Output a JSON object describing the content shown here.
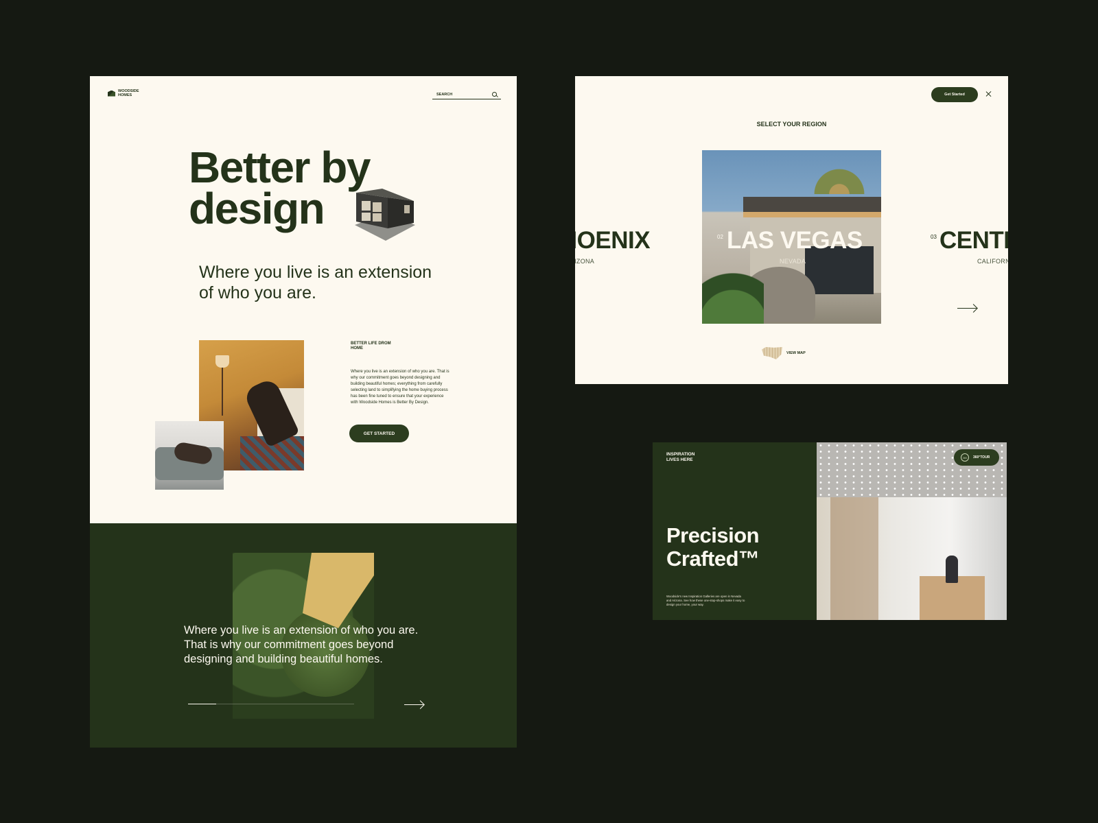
{
  "home": {
    "logo_text": "WOODSIDE HOMES",
    "search_label": "SEARCH",
    "hero_line1": "Better by",
    "hero_line2": "design",
    "subtitle": "Where you live is an extension of who you are.",
    "kicker": "BETTER LIFE DROM HOME",
    "body": "Where you live is an extension of who you are. That is why our commitment goes beyond designing and building beautiful homes; everything from carefully selecting land to simplifying the home buying process has been fine tuned to ensure that your experience with Woodside Homes is Better By Design.",
    "cta": "GET STARTED"
  },
  "quote": {
    "text": "Where you live is an extension of who you are. That is why our commitment goes beyond designing and building beautiful homes.",
    "progress": 0.17
  },
  "region": {
    "cta": "Get Started",
    "title": "SELECT YOUR REGION",
    "regions": [
      {
        "num": "",
        "city": "PHOENIX",
        "state": "ARIZONA"
      },
      {
        "num": "02",
        "city": "LAS VEGAS",
        "state": "NEVADA"
      },
      {
        "num": "03",
        "city": "CENTRAL",
        "state": "CALIFORNIA"
      }
    ],
    "view_map": "VIEW MAP"
  },
  "precision": {
    "kicker": "INSPIRATION LIVES HERE",
    "title_line1": "Precision",
    "title_line2": "Crafted™",
    "body": "Woodside's new Inspiration Galleries are open in Nevada and Arizona. See how these one-stop-shops make it easy to design your home, your way.",
    "tour_label": "360°TOUR",
    "tour_icon_text": "360"
  },
  "colors": {
    "brand_green": "#24331a",
    "cream": "#fdf9f0",
    "background": "#151912"
  }
}
